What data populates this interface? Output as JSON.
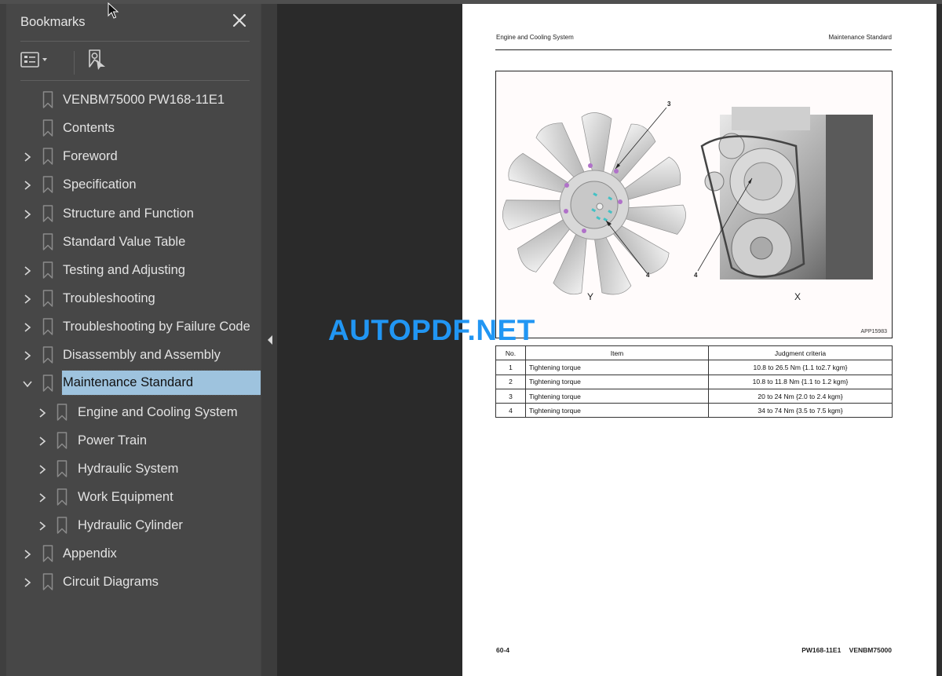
{
  "sidebar": {
    "title": "Bookmarks",
    "close_icon": "close-icon",
    "tools": [
      {
        "name": "bookmark-options",
        "icon": "list-options-icon"
      },
      {
        "name": "find-current-bookmark",
        "icon": "bookmark-find-icon"
      }
    ],
    "items": [
      {
        "label": "VENBM75000 PW168-11E1",
        "level": 0,
        "expandable": false
      },
      {
        "label": "Contents",
        "level": 0,
        "expandable": false
      },
      {
        "label": "Foreword",
        "level": 0,
        "expandable": true,
        "expanded": false
      },
      {
        "label": "Specification",
        "level": 0,
        "expandable": true,
        "expanded": false
      },
      {
        "label": "Structure and Function",
        "level": 0,
        "expandable": true,
        "expanded": false
      },
      {
        "label": "Standard Value Table",
        "level": 0,
        "expandable": false
      },
      {
        "label": "Testing and Adjusting",
        "level": 0,
        "expandable": true,
        "expanded": false
      },
      {
        "label": "Troubleshooting",
        "level": 0,
        "expandable": true,
        "expanded": false
      },
      {
        "label": "Troubleshooting by Failure Code",
        "level": 0,
        "expandable": true,
        "expanded": false
      },
      {
        "label": "Disassembly and Assembly",
        "level": 0,
        "expandable": true,
        "expanded": false
      },
      {
        "label": "Maintenance Standard",
        "level": 0,
        "expandable": true,
        "expanded": true,
        "selected": true
      },
      {
        "label": "Engine and Cooling System",
        "level": 1,
        "expandable": true,
        "expanded": false
      },
      {
        "label": "Power Train",
        "level": 1,
        "expandable": true,
        "expanded": false
      },
      {
        "label": "Hydraulic System",
        "level": 1,
        "expandable": true,
        "expanded": false
      },
      {
        "label": "Work Equipment",
        "level": 1,
        "expandable": true,
        "expanded": false
      },
      {
        "label": "Hydraulic Cylinder",
        "level": 1,
        "expandable": true,
        "expanded": false
      },
      {
        "label": "Appendix",
        "level": 0,
        "expandable": true,
        "expanded": false
      },
      {
        "label": "Circuit Diagrams",
        "level": 0,
        "expandable": true,
        "expanded": false
      }
    ],
    "selected_color": "#9ec3de"
  },
  "page": {
    "header_left": "Engine and Cooling System",
    "header_right": "Maintenance Standard",
    "figure": {
      "view_left_label": "Y",
      "view_right_label": "X",
      "callouts": [
        "3",
        "4",
        "4"
      ],
      "code": "APP15983"
    },
    "table": {
      "headers": [
        "No.",
        "Item",
        "Judgment criteria"
      ],
      "rows": [
        [
          "1",
          "Tightening torque",
          "10.8 to 26.5 Nm {1.1 to2.7 kgm}"
        ],
        [
          "2",
          "Tightening torque",
          "10.8 to 11.8 Nm {1.1 to 1.2 kgm}"
        ],
        [
          "3",
          "Tightening torque",
          "20 to 24 Nm {2.0 to 2.4 kgm}"
        ],
        [
          "4",
          "Tightening torque",
          "34 to 74 Nm {3.5 to 7.5 kgm}"
        ]
      ]
    },
    "footer_left": "60-4",
    "footer_right": "PW168-11E1 VENBM75000"
  },
  "watermark": {
    "text": "AUTOPDF.NET",
    "color": "#2196f3"
  }
}
